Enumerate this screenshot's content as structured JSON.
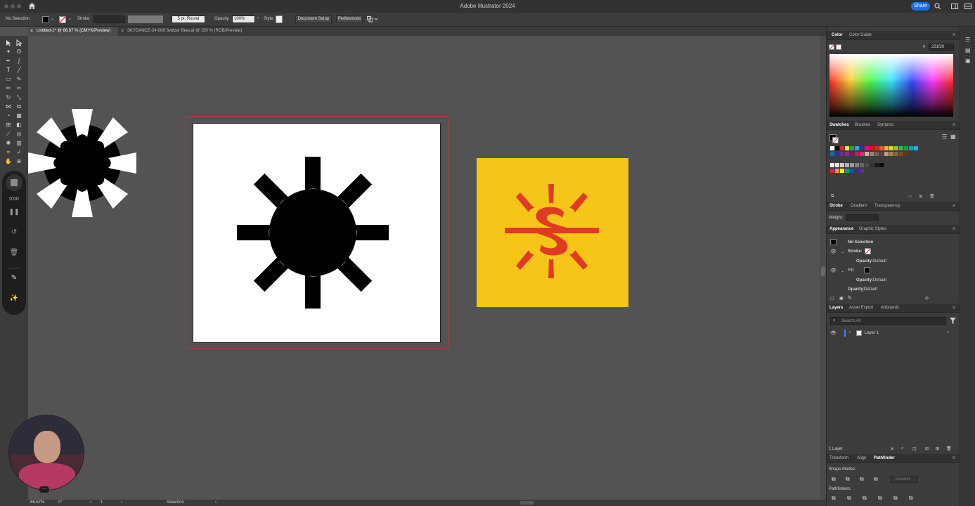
{
  "app": {
    "title": "Adobe Illustrator 2024",
    "share_label": "Share"
  },
  "control_bar": {
    "selection_status": "No Selection",
    "stroke_label": "Stroke",
    "brush_value": "5 pt. Round",
    "opacity_label": "Opacity",
    "opacity_value": "100%",
    "style_label": "Style:",
    "document_setup_label": "Document Setup",
    "preferences_label": "Preferences"
  },
  "tabs": [
    {
      "label": "Untitled-2* @ 66.67 % (CMYK/Preview)",
      "active": true
    },
    {
      "label": "SKYDANCE-24-006 Switzer Beer.ai @ 150 % (RGB/Preview)",
      "active": false
    }
  ],
  "recording": {
    "timer": "0:00"
  },
  "status_bar": {
    "zoom": "66.67%",
    "rotation": "0°",
    "artboard_number": "1",
    "tool_name": "Selection"
  },
  "color_panel": {
    "tabs": [
      "Color",
      "Color Guide"
    ],
    "hex_symbol": "#",
    "hex_value": "231f20"
  },
  "swatches_panel": {
    "tabs": [
      "Swatches",
      "Brushes",
      "Symbols"
    ]
  },
  "stroke_panel": {
    "tabs": [
      "Stroke",
      "Gradient",
      "Transparency"
    ],
    "weight_label": "Weight:"
  },
  "appearance_panel": {
    "tabs": [
      "Appearance",
      "Graphic Styles"
    ],
    "selection_label": "No Selection",
    "stroke_label": "Stroke:",
    "stroke_opacity": "Opacity:",
    "stroke_opacity_value": "Default",
    "fill_label": "Fill:",
    "fill_opacity": "Opacity:",
    "fill_opacity_value": "Default",
    "overall_opacity": "Opacity:",
    "overall_opacity_value": "Default",
    "fx_label": "fx."
  },
  "layers_panel": {
    "tabs": [
      "Layers",
      "Asset Export",
      "Artboards"
    ],
    "search_placeholder": "Search All",
    "layer_name": "Layer 1",
    "footer_count": "1 Layer"
  },
  "pathfinder_panel": {
    "tabs": [
      "Transform",
      "Align",
      "Pathfinder"
    ],
    "shape_modes_label": "Shape Modes:",
    "expand_label": "Expand",
    "pathfinders_label": "Pathfinders:"
  },
  "colors": {
    "accent": "#1473e6",
    "logo_background": "#f5c518",
    "logo_mark": "#e03b22",
    "artboard": "#ffffff",
    "canvas": "#535353"
  },
  "swatch_rows": [
    [
      "#ffffff",
      "#000000",
      "#e4232a",
      "#f9ec31",
      "#16a748",
      "#25aae1",
      "#2e3192",
      "#ec008c",
      "#ff0000",
      "#ee1c25",
      "#f15a24",
      "#fbb03b",
      "#d9e021",
      "#8cc63f",
      "#39b54a",
      "#00a651",
      "#00a99d",
      "#29abe2"
    ],
    [
      "#0071bc",
      "#2e3192",
      "#662d91",
      "#93278f",
      "#9e005d",
      "#d4145a",
      "#ed1e79",
      "#c7b299",
      "#998675",
      "#736357",
      "#534741",
      "#c69c6d",
      "#a67c52",
      "#8c6239",
      "#754c24",
      "#603813"
    ],
    [
      "#ffffff",
      "#e6e6e6",
      "#cccccc",
      "#b3b3b3",
      "#999999",
      "#808080",
      "#666666",
      "#4d4d4d",
      "#333333",
      "#1a1a1a",
      "#000000"
    ],
    [
      "#ed1c24",
      "#f7941d",
      "#fff200",
      "#00a651",
      "#0054a6",
      "#2e3192",
      "#662d91"
    ]
  ]
}
